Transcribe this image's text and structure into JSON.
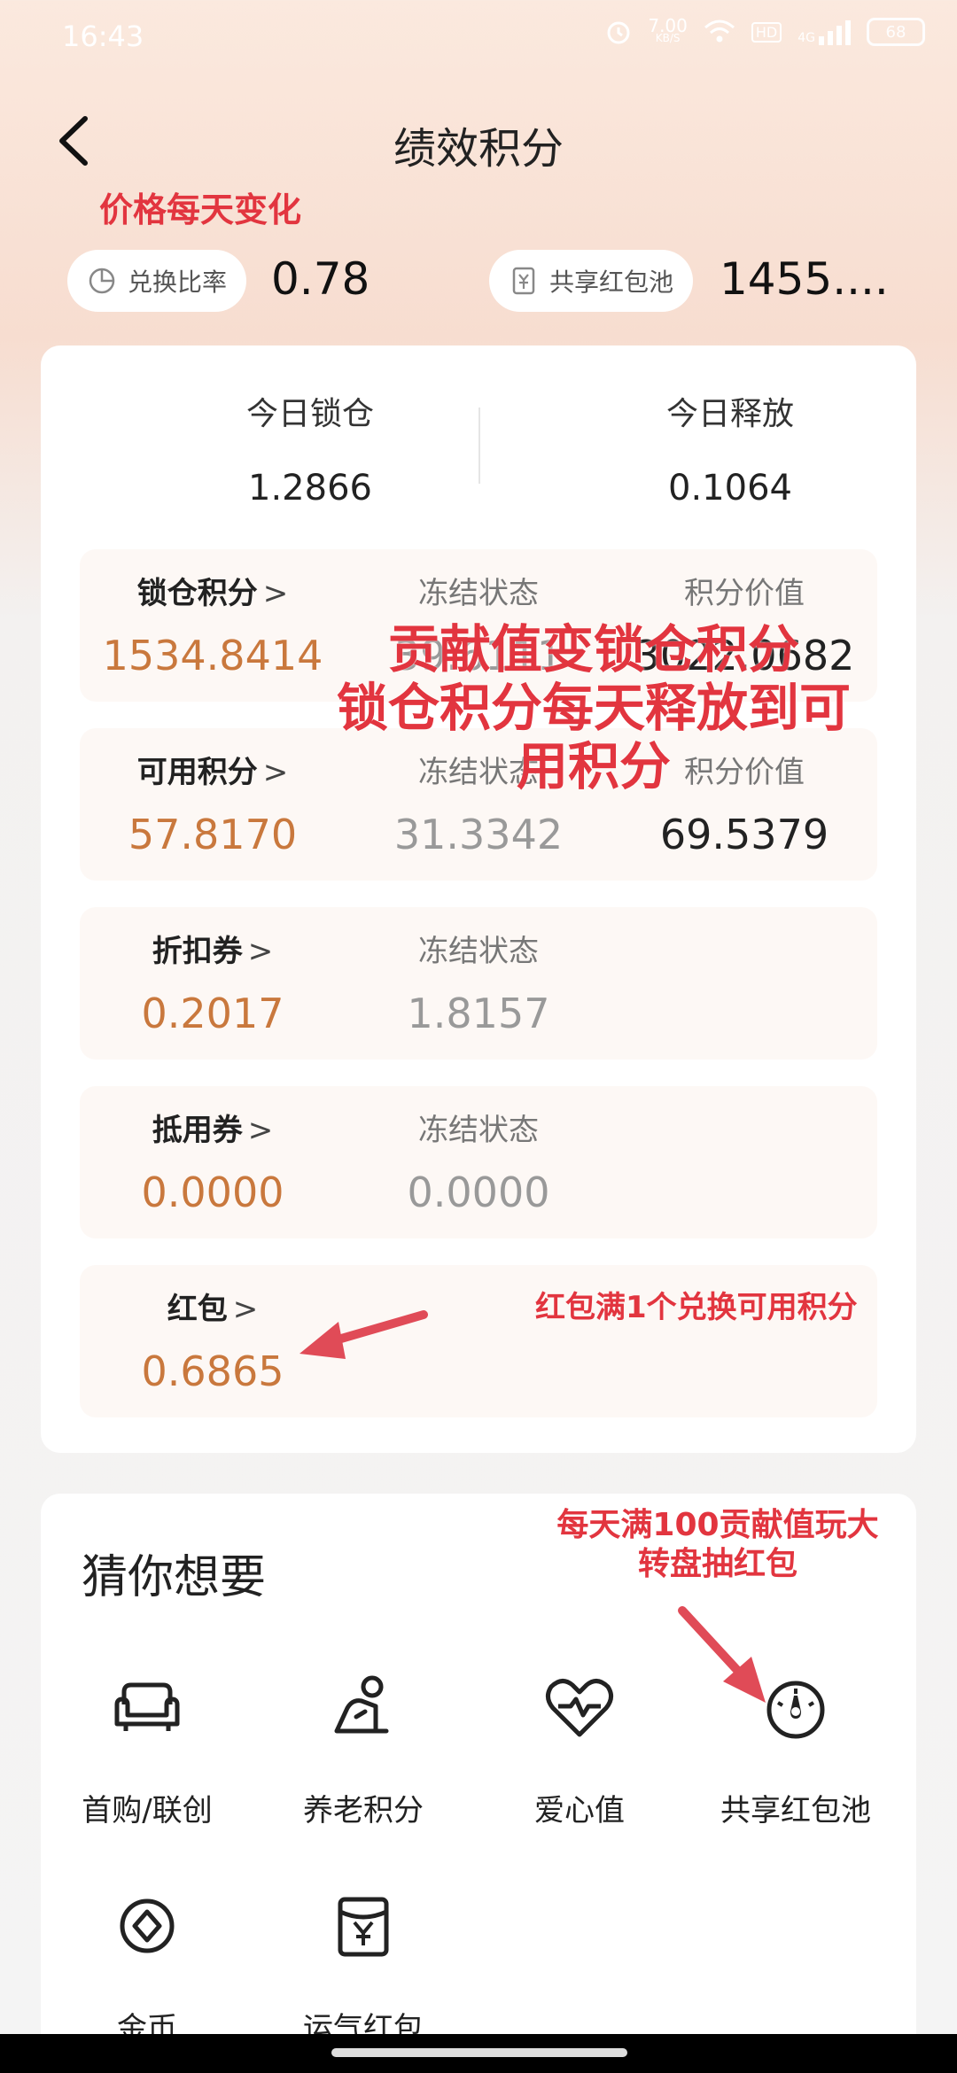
{
  "status_bar": {
    "time": "16:43",
    "speed": "7.00",
    "speed_unit": "KB/S",
    "network": "4G",
    "hd": "HD",
    "battery": "68"
  },
  "header": {
    "title": "绩效积分"
  },
  "annotations": {
    "price_note": "价格每天变化",
    "lock_note_1": "贡献值变锁仓积分",
    "lock_note_2": "锁仓积分每天释放到可",
    "lock_note_3": "用积分",
    "redpack_note": "红包满1个兑换可用积分",
    "wheel_note_1": "每天满100贡献值玩大",
    "wheel_note_2": "转盘抽红包"
  },
  "rates": {
    "exchange_label": "兑换比率",
    "exchange_value": "0.78",
    "pool_label": "共享红包池",
    "pool_value": "1455...."
  },
  "today": {
    "locked_label": "今日锁仓",
    "locked_value": "1.2866",
    "released_label": "今日释放",
    "released_value": "0.1064"
  },
  "points": [
    {
      "label": "锁仓积分",
      "value": "1534.8414",
      "frozen_label": "冻结状态",
      "frozen_value": "39.6111",
      "worth_label": "积分价值",
      "worth_value": "3022.0682"
    },
    {
      "label": "可用积分",
      "value": "57.8170",
      "frozen_label": "冻结状态",
      "frozen_value": "31.3342",
      "worth_label": "积分价值",
      "worth_value": "69.5379"
    },
    {
      "label": "折扣券",
      "value": "0.2017",
      "frozen_label": "冻结状态",
      "frozen_value": "1.8157"
    },
    {
      "label": "抵用券",
      "value": "0.0000",
      "frozen_label": "冻结状态",
      "frozen_value": "0.0000"
    },
    {
      "label": "红包",
      "value": "0.6865"
    }
  ],
  "chevron": ">",
  "guess": {
    "title": "猜你想要",
    "items": [
      {
        "label": "首购/联创",
        "icon": "sofa-icon"
      },
      {
        "label": "养老积分",
        "icon": "elderly-icon"
      },
      {
        "label": "爱心值",
        "icon": "heart-icon"
      },
      {
        "label": "共享红包池",
        "icon": "dial-icon"
      },
      {
        "label": "金币",
        "icon": "coin-icon"
      },
      {
        "label": "运气红包",
        "icon": "red-envelope-icon"
      }
    ]
  },
  "colors": {
    "accent": "#c9783d",
    "annotation": "#e2353f"
  }
}
